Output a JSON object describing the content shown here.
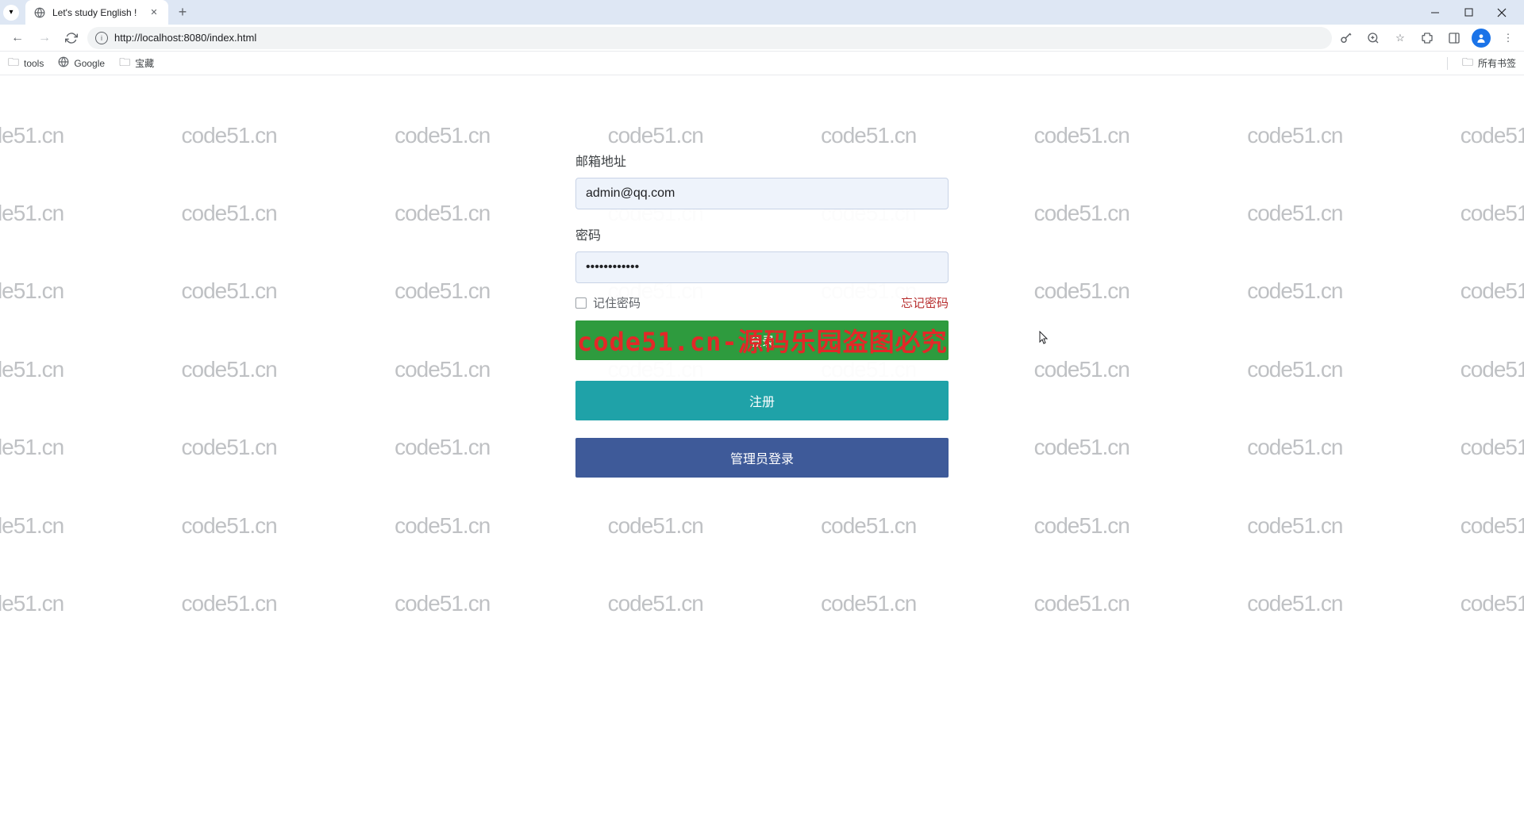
{
  "browser": {
    "tab_title": "Let's study English !",
    "url": "http://localhost:8080/index.html",
    "bookmarks": [
      {
        "label": "tools",
        "type": "folder"
      },
      {
        "label": "Google",
        "type": "site"
      },
      {
        "label": "宝藏",
        "type": "folder"
      }
    ],
    "all_bookmarks_label": "所有书签"
  },
  "login": {
    "email_label": "邮箱地址",
    "email_value": "admin@qq.com",
    "password_label": "密码",
    "password_value": "••••••••••••",
    "remember_label": "记住密码",
    "forgot_label": "忘记密码",
    "login_btn": "登录",
    "register_btn": "注册",
    "admin_btn": "管理员登录"
  },
  "watermark": {
    "text": "code51.cn",
    "overlay_text": "code51.cn-源码乐园盗图必究"
  }
}
